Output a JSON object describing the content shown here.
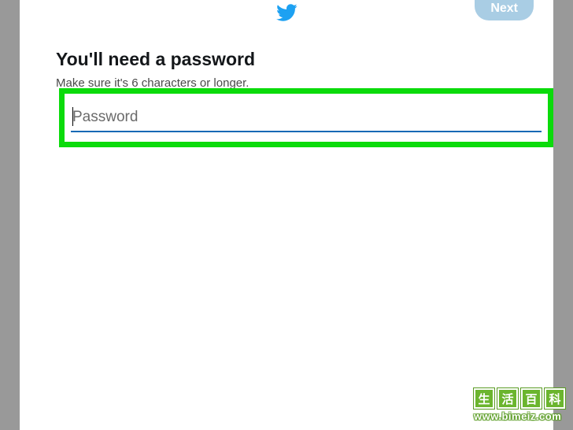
{
  "header": {
    "next_label": "Next"
  },
  "content": {
    "title": "You'll need a password",
    "subtitle": "Make sure it's 6 characters or longer.",
    "password_placeholder": "Password"
  },
  "watermark": {
    "chars": [
      "生",
      "活",
      "百",
      "科"
    ],
    "url": "www.bimeiz.com"
  }
}
